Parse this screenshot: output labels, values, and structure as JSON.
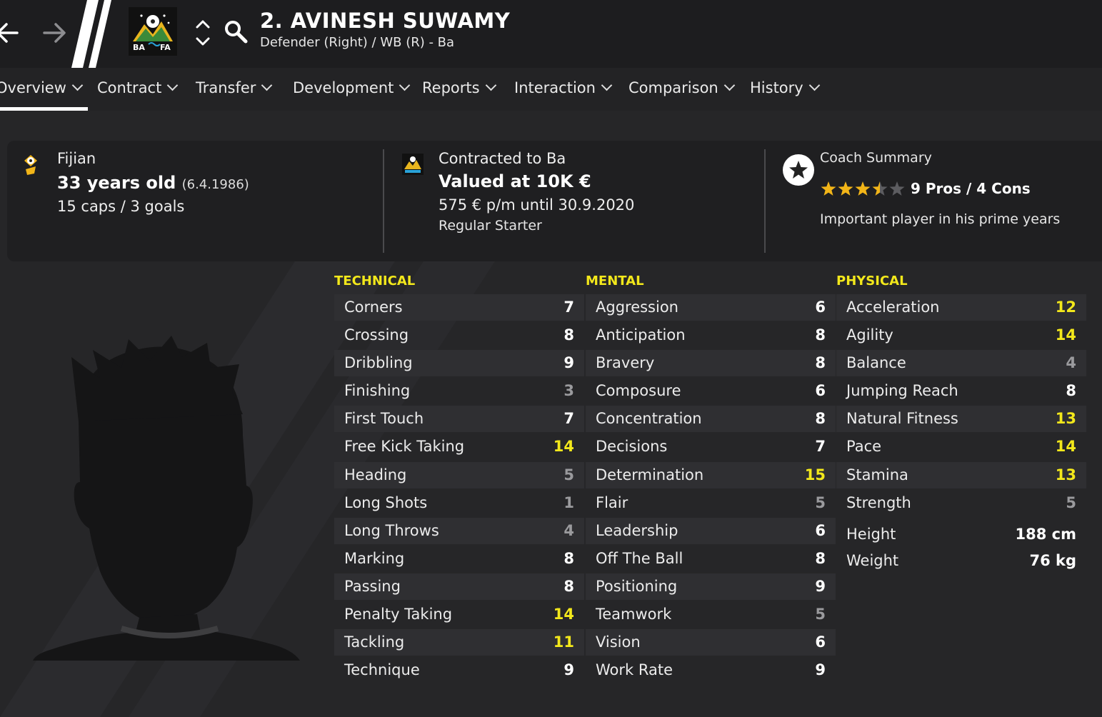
{
  "header": {
    "title": "2. AVINESH SUWAMY",
    "subtitle": "Defender (Right) / WB (R) - Ba",
    "badge_text_left": "BA",
    "badge_text_right": "FA"
  },
  "tabs": [
    {
      "label": "Overview"
    },
    {
      "label": "Contract"
    },
    {
      "label": "Transfer"
    },
    {
      "label": "Development"
    },
    {
      "label": "Reports"
    },
    {
      "label": "Interaction"
    },
    {
      "label": "Comparison"
    },
    {
      "label": "History"
    }
  ],
  "info": {
    "nationality": "Fijian",
    "age": "33 years old",
    "dob": "(6.4.1986)",
    "caps": "15 caps / 3 goals",
    "contract_line": "Contracted to Ba",
    "value": "Valued at 10K €",
    "wage": "575 € p/m until 30.9.2020",
    "squad_status": "Regular Starter",
    "coach_title": "Coach Summary",
    "stars": 3.5,
    "max_stars": 5,
    "pros_cons": "9 Pros / 4 Cons",
    "summary": "Important player in his prime years"
  },
  "technical": {
    "heading": "TECHNICAL",
    "rows": [
      {
        "label": "Corners",
        "value": "7"
      },
      {
        "label": "Crossing",
        "value": "8"
      },
      {
        "label": "Dribbling",
        "value": "9"
      },
      {
        "label": "Finishing",
        "value": "3"
      },
      {
        "label": "First Touch",
        "value": "7"
      },
      {
        "label": "Free Kick Taking",
        "value": "14"
      },
      {
        "label": "Heading",
        "value": "5"
      },
      {
        "label": "Long Shots",
        "value": "1"
      },
      {
        "label": "Long Throws",
        "value": "4"
      },
      {
        "label": "Marking",
        "value": "8"
      },
      {
        "label": "Passing",
        "value": "8"
      },
      {
        "label": "Penalty Taking",
        "value": "14"
      },
      {
        "label": "Tackling",
        "value": "11"
      },
      {
        "label": "Technique",
        "value": "9"
      }
    ]
  },
  "mental": {
    "heading": "MENTAL",
    "rows": [
      {
        "label": "Aggression",
        "value": "6"
      },
      {
        "label": "Anticipation",
        "value": "8"
      },
      {
        "label": "Bravery",
        "value": "8"
      },
      {
        "label": "Composure",
        "value": "6"
      },
      {
        "label": "Concentration",
        "value": "8"
      },
      {
        "label": "Decisions",
        "value": "7"
      },
      {
        "label": "Determination",
        "value": "15"
      },
      {
        "label": "Flair",
        "value": "5"
      },
      {
        "label": "Leadership",
        "value": "6"
      },
      {
        "label": "Off The Ball",
        "value": "8"
      },
      {
        "label": "Positioning",
        "value": "9"
      },
      {
        "label": "Teamwork",
        "value": "5"
      },
      {
        "label": "Vision",
        "value": "6"
      },
      {
        "label": "Work Rate",
        "value": "9"
      }
    ]
  },
  "physical": {
    "heading": "PHYSICAL",
    "rows": [
      {
        "label": "Acceleration",
        "value": "12"
      },
      {
        "label": "Agility",
        "value": "14"
      },
      {
        "label": "Balance",
        "value": "4"
      },
      {
        "label": "Jumping Reach",
        "value": "8"
      },
      {
        "label": "Natural Fitness",
        "value": "13"
      },
      {
        "label": "Pace",
        "value": "14"
      },
      {
        "label": "Stamina",
        "value": "13"
      },
      {
        "label": "Strength",
        "value": "5"
      }
    ],
    "height_label": "Height",
    "height_value": "188 cm",
    "weight_label": "Weight",
    "weight_value": "76 kg"
  },
  "colors": {
    "accent_yellow": "#f3e81b",
    "low_grey": "#9a9a9d",
    "star": "#f2b518",
    "star_empty": "#5c5c60"
  }
}
